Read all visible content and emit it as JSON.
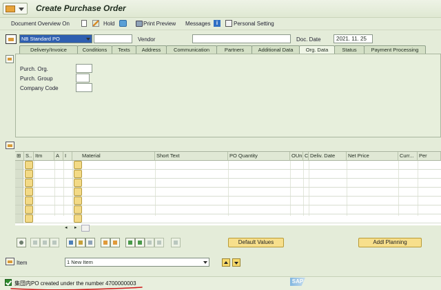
{
  "window": {
    "title": "Create Purchase Order"
  },
  "toolbar": {
    "doc_overview": "Document Overview On",
    "hold": "Hold",
    "print_preview": "Print Preview",
    "messages": "Messages",
    "personal_setting": "Personal Setting"
  },
  "header": {
    "order_type": "NB Standard PO",
    "vendor_label": "Vendor",
    "doc_date_label": "Doc. Date",
    "doc_date": "2021. 11. 25"
  },
  "tabs": [
    "Delivery/Invoice",
    "Conditions",
    "Texts",
    "Address",
    "Communication",
    "Partners",
    "Additional Data",
    "Org. Data",
    "Status",
    "Payment Processing"
  ],
  "org_data": {
    "purch_org_label": "Purch. Org.",
    "purch_group_label": "Purch. Group",
    "company_code_label": "Company Code"
  },
  "grid": {
    "columns": [
      "S..",
      "Itm",
      "A",
      "I",
      "Material",
      "Short Text",
      "PO Quantity",
      "OUn",
      "C",
      "Deliv. Date",
      "Net Price",
      "Curr...",
      "Per"
    ],
    "scroll_left": "◂",
    "scroll_right": "▸"
  },
  "buttons": {
    "default_values": "Default Values",
    "addl_planning": "Addl Planning"
  },
  "item_section": {
    "label": "Item",
    "selected": "1 New Item"
  },
  "status": {
    "message": "集団内PO created under the number 4700000003",
    "logo": "SAP"
  },
  "colors": {
    "accent_select": "#2f5fb0",
    "button_yellow": "#f7df8c",
    "success_green": "#2e8b2e",
    "annotation_red": "#d01818"
  }
}
